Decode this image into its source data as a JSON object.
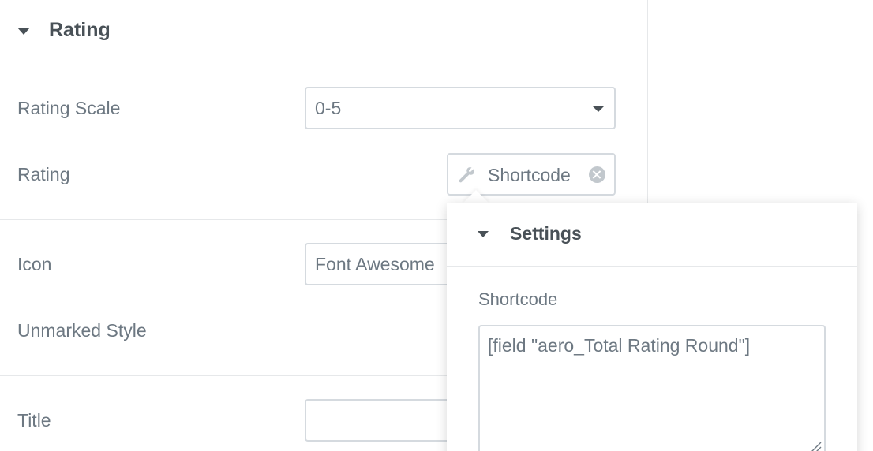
{
  "section": {
    "title": "Rating"
  },
  "rating_scale": {
    "label": "Rating Scale",
    "value": "0-5"
  },
  "rating": {
    "label": "Rating",
    "dynamic_tag": "Shortcode",
    "icon": "wrench-icon"
  },
  "icon": {
    "label": "Icon",
    "value": "Font Awesome"
  },
  "unmarked_style": {
    "label": "Unmarked Style"
  },
  "title_field": {
    "label": "Title",
    "value": ""
  },
  "popover": {
    "heading": "Settings",
    "shortcode_label": "Shortcode",
    "shortcode_value": "[field \"aero_Total Rating Round\"]"
  },
  "colors": {
    "text": "#6d7882",
    "heading": "#495157",
    "border": "#d5dadf",
    "divider": "#e6e8ea"
  }
}
